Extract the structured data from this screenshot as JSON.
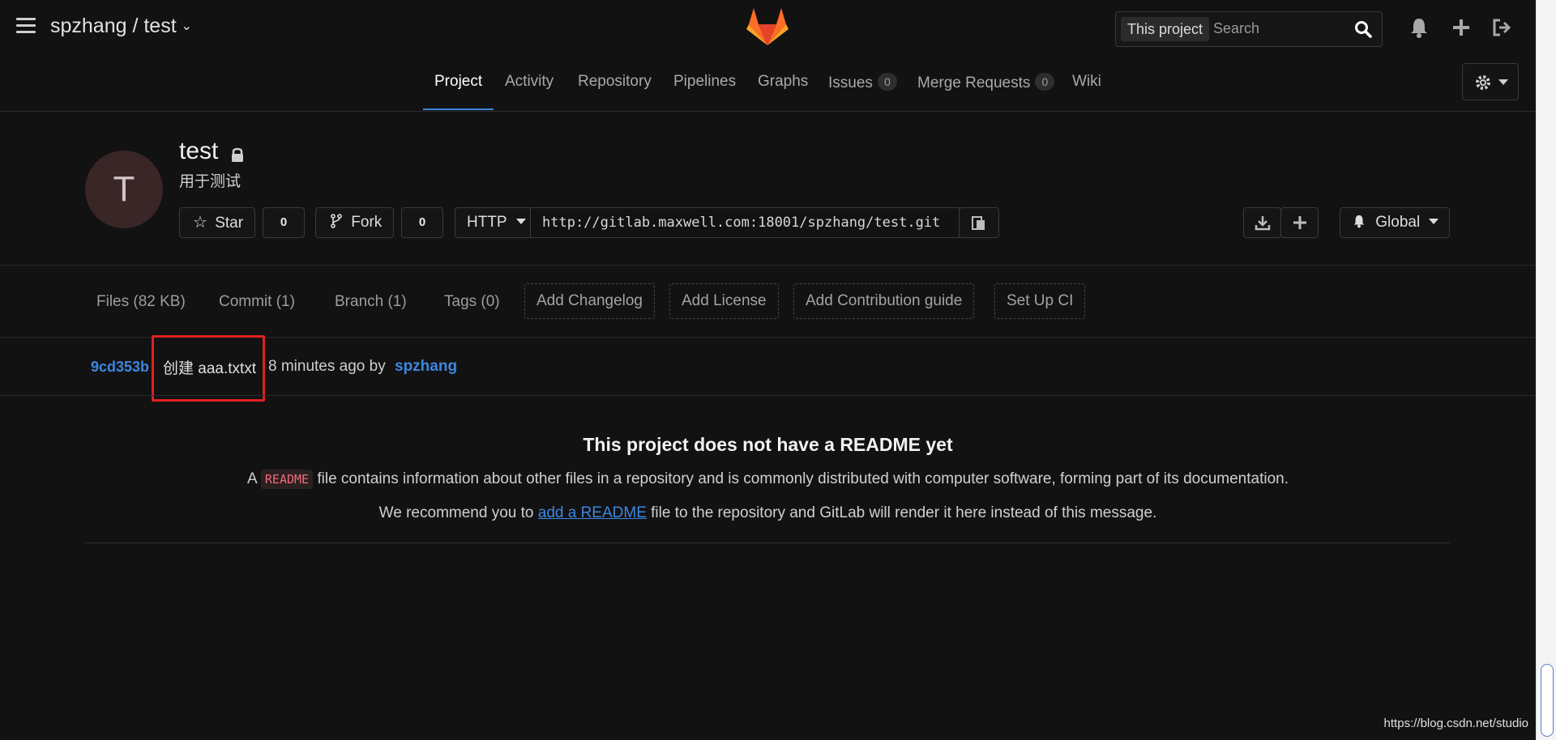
{
  "header": {
    "project_path": "spzhang / test",
    "search": {
      "scope": "This project",
      "placeholder": "Search"
    }
  },
  "nav": {
    "tabs": [
      {
        "label": "Project",
        "active": true
      },
      {
        "label": "Activity"
      },
      {
        "label": "Repository"
      },
      {
        "label": "Pipelines"
      },
      {
        "label": "Graphs"
      },
      {
        "label": "Issues",
        "count": "0"
      },
      {
        "label": "Merge Requests",
        "count": "0"
      },
      {
        "label": "Wiki"
      }
    ]
  },
  "project": {
    "avatar_letter": "T",
    "name": "test",
    "description": "用于测试",
    "star_label": "Star",
    "star_count": "0",
    "fork_label": "Fork",
    "fork_count": "0",
    "protocol": "HTTP",
    "clone_url": "http://gitlab.maxwell.com:18001/spzhang/test.git",
    "notification_level": "Global"
  },
  "stats": {
    "files": "Files (82 KB)",
    "commits": "Commit (1)",
    "branches": "Branch (1)",
    "tags": "Tags (0)",
    "add_changelog": "Add Changelog",
    "add_license": "Add License",
    "add_contribution": "Add Contribution guide",
    "setup_ci": "Set Up CI"
  },
  "commit": {
    "sha": "9cd353b",
    "message": "创建 aaa.txtxt",
    "time": "8 minutes ago by",
    "author": "spzhang"
  },
  "readme": {
    "title": "This project does not have a README yet",
    "p1_prefix": "A",
    "p1_code": "README",
    "p1_suffix": "file contains information about other files in a repository and is commonly distributed with computer software, forming part of its documentation.",
    "p2_prefix": "We recommend you to",
    "p2_link": "add a README",
    "p2_suffix": "file to the repository and GitLab will render it here instead of this message."
  },
  "watermark": "https://blog.csdn.net/studio",
  "colors": {
    "background": "#121212",
    "accent": "#3d87e0",
    "highlight_box": "#e02020",
    "code_text": "#f06a7c"
  }
}
